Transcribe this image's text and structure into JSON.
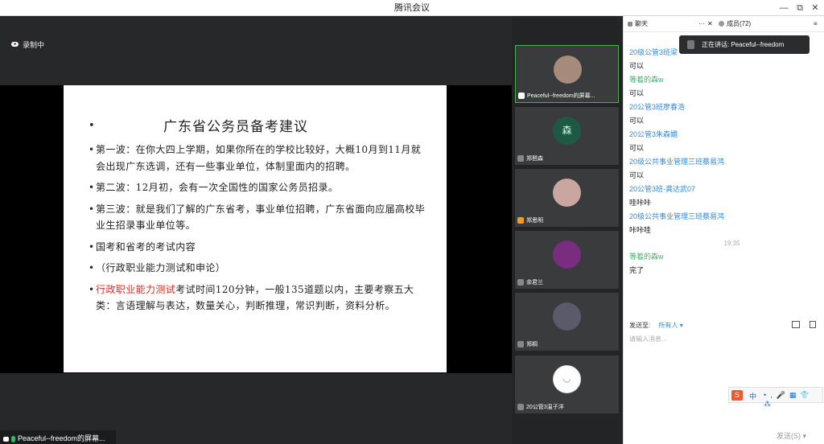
{
  "window": {
    "title": "腾讯会议",
    "minimize_icon": "—",
    "maximize_icon": "⧉",
    "close_icon": "✕"
  },
  "recording": {
    "label": "录制中"
  },
  "slide": {
    "bullet": "•",
    "title": "广东省公务员备考建议",
    "points": [
      {
        "text": "第一波：在你大四上学期，如果你所在的学校比较好，大概10月到11月就会出现广东选调，还有一些事业单位，体制里面内的招聘。"
      },
      {
        "text": "第二波：12月初，会有一次全国性的国家公务员招录。"
      },
      {
        "text": "第三波：就是我们了解的广东省考，事业单位招聘，广东省面向应届高校毕业生招录事业单位等。"
      },
      {
        "text": "国考和省考的考试内容"
      },
      {
        "text": "（行政职业能力测试和申论）"
      },
      {
        "highlight": "行政职业能力测试",
        "text": "考试时间120分钟，一般135道题以内，主要考察五大类：言语理解与表达，数量关心，判断推理，常识判断，资料分析。"
      }
    ]
  },
  "presenter_bar": {
    "label": "Peaceful--freedom的屏幕..."
  },
  "participants": [
    {
      "name": "Peaceful--freedom的屏幕...",
      "avatar": "#a68a7a",
      "active": true
    },
    {
      "name": "郑琶森",
      "avatar": "#1e5a43",
      "avatar_text": "森"
    },
    {
      "name": "郑思明",
      "avatar": "#c9a6a0"
    },
    {
      "name": "余君兰",
      "avatar": "#7a2c7e"
    },
    {
      "name": "郑桐",
      "avatar": "#5a5a6a"
    },
    {
      "name": "20公管3温子洋",
      "avatar": "#ffffff"
    }
  ],
  "chat": {
    "tab_chat": "聊天",
    "tab_more": "···",
    "tab_close": "✕",
    "tab_members": "成员(72)",
    "tab_menu": "≡",
    "speaking": "正在讲话: Peaceful--freedom",
    "messages": [
      {
        "name": "20级公管3班梁",
        "text": "可以"
      },
      {
        "name": "等着的森w",
        "green": true,
        "text": "可以"
      },
      {
        "name": "20公管3班廖春浩",
        "text": "可以"
      },
      {
        "name": "20公管3朱森媚",
        "text": "可以"
      },
      {
        "name": "20级公共事业管理三班蔡易鸿",
        "text": "可以"
      },
      {
        "name": "20公管3班-龚达武07",
        "text": "哇咔咔"
      },
      {
        "name": "20级公共事业管理三班蔡易鸿",
        "text": "咔咔哇"
      },
      {
        "time": "19:35"
      },
      {
        "name": "等着的森w",
        "green": true,
        "text": "完了"
      }
    ],
    "send_to_label": "发送至:",
    "send_to_value": "所有人 ▾",
    "input_placeholder": "请输入消息...",
    "send_button": "发送(S)"
  },
  "ime": {
    "logo": "S",
    "lang": "中",
    "icons": [
      "•,",
      "🎤",
      "▦",
      "👕",
      "⁂"
    ]
  }
}
